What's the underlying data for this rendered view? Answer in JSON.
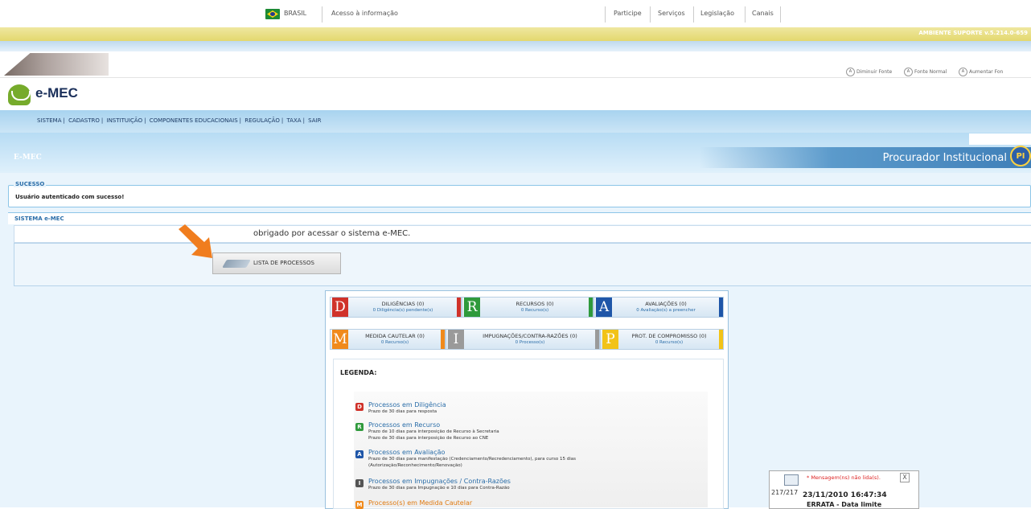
{
  "gov_bar": {
    "brasil": "BRASIL",
    "acesso": "Acesso à informação",
    "links": [
      "Participe",
      "Serviços",
      "Legislação",
      "Canais"
    ]
  },
  "env": {
    "label": "AMBIENTE SUPORTE v.5.214.0-659"
  },
  "font_controls": {
    "decrease": "Diminuir Fonte",
    "normal": "Fonte Normal",
    "increase": "Aumentar Fon"
  },
  "logo": {
    "text": "e-MEC"
  },
  "nav": {
    "items": [
      "SISTEMA",
      "CADASTRO",
      "INSTITUIÇÃO",
      "COMPONENTES EDUCACIONAIS",
      "REGULAÇÃO",
      "TAXA",
      "SAIR"
    ]
  },
  "hero": {
    "section": "E-MEC",
    "role": "Procurador Institucional",
    "role_badge": "PI"
  },
  "success": {
    "legend": "SUCESSO",
    "message": "Usuário autenticado com sucesso!"
  },
  "system": {
    "title": "SISTEMA e-MEC",
    "thanks": "obrigado por acessar o sistema e-MEC."
  },
  "lista_button": {
    "label": "LISTA DE PROCESSOS"
  },
  "tiles": [
    {
      "letter": "D",
      "title": "DILIGÊNCIAS (0)",
      "sub": "0 Diligência(s) pendente(s)",
      "color": "#d0322a"
    },
    {
      "letter": "R",
      "title": "RECURSOS (0)",
      "sub": "0 Recurso(s)",
      "color": "#2f9a3c"
    },
    {
      "letter": "A",
      "title": "AVALIAÇÕES (0)",
      "sub": "0 Avaliação(s) a preencher",
      "color": "#1f56a8"
    },
    {
      "letter": "M",
      "title": "MEDIDA CAUTELAR (0)",
      "sub": "0 Recurso(s)",
      "color": "#f08a1c"
    },
    {
      "letter": "I",
      "title": "IMPUGNAÇÕES/CONTRA-RAZÕES (0)",
      "sub": "0 Processo(s)",
      "color": "#9a9a9a"
    },
    {
      "letter": "P",
      "title": "PROT. DE COMPROMISSO (0)",
      "sub": "0 Recurso(s)",
      "color": "#f2c318"
    }
  ],
  "legenda": {
    "title": "LEGENDA:",
    "items": [
      {
        "icon": "D",
        "heading": "Processos em Diligência",
        "lines": [
          "Prazo de 30 dias para resposta"
        ]
      },
      {
        "icon": "R",
        "heading": "Processos em Recurso",
        "lines": [
          "Prazo de 10 dias para interposição de Recurso à Secretaria",
          "Prazo de 30 dias para interposição de Recurso ao CNE"
        ]
      },
      {
        "icon": "A",
        "heading": "Processos em Avaliação",
        "lines": [
          "Prazo de 30 dias para manifestação (Credenciamento/Recredenciamento), para curso 15 dias",
          "(Autorização/Reconhecimento/Renovação)"
        ]
      },
      {
        "icon": "I",
        "heading": "Processos em Impugnações / Contra-Razões",
        "lines": [
          "Prazo de 30 dias para Impugnação e 10 dias para Contra-Razão"
        ]
      },
      {
        "icon": "M",
        "heading": "Processo(s) em Medida Cautelar",
        "lines": []
      }
    ]
  },
  "notification": {
    "unread": "* Mensagem(ns) não lida(s).",
    "count": "217/217",
    "date": "23/11/2010 16:47:34",
    "errata": "ERRATA - Data limite",
    "close": "X"
  }
}
